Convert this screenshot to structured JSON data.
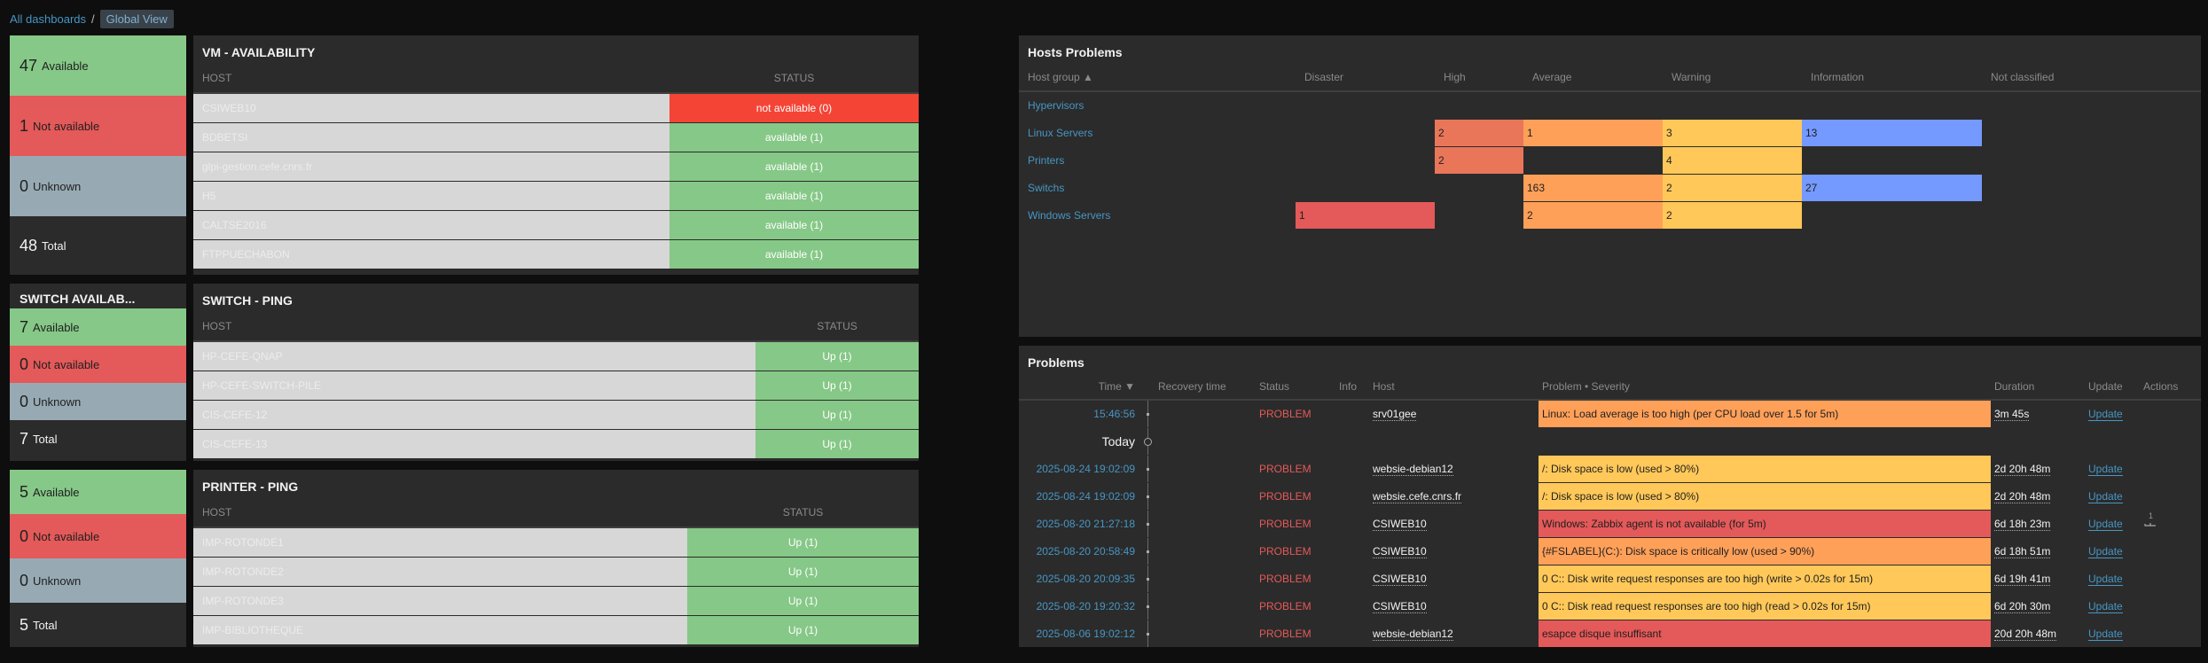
{
  "breadcrumb": {
    "root": "All dashboards",
    "separator": "/",
    "current": "Global View"
  },
  "vm_avail": {
    "available": "47",
    "available_label": "Available",
    "not_available": "1",
    "not_available_label": "Not available",
    "unknown": "0",
    "unknown_label": "Unknown",
    "total": "48",
    "total_label": "Total"
  },
  "switch_avail": {
    "title": "SWITCH AVAILAB...",
    "available": "7",
    "available_label": "Available",
    "not_available": "0",
    "not_available_label": "Not available",
    "unknown": "0",
    "unknown_label": "Unknown",
    "total": "7",
    "total_label": "Total"
  },
  "printer_avail": {
    "available": "5",
    "available_label": "Available",
    "not_available": "0",
    "not_available_label": "Not available",
    "unknown": "0",
    "unknown_label": "Unknown",
    "total": "5",
    "total_label": "Total"
  },
  "vm_table": {
    "title": "VM - AVAILABILITY",
    "col_host": "HOST",
    "col_status": "STATUS",
    "rows": [
      {
        "host": "CSIWEB10",
        "status": "not available (0)"
      },
      {
        "host": "BDBETSI",
        "status": "available (1)"
      },
      {
        "host": "glpi-gestion.cefe.cnrs.fr",
        "status": "available (1)"
      },
      {
        "host": "H5",
        "status": "available (1)"
      },
      {
        "host": "CALTSE2016",
        "status": "available (1)"
      },
      {
        "host": "FTPPUECHABON",
        "status": "available (1)"
      }
    ]
  },
  "switch_table": {
    "title": "SWITCH - PING",
    "col_host": "HOST",
    "col_status": "STATUS",
    "rows": [
      {
        "host": "HP-CEFE-QNAP",
        "status": "Up (1)"
      },
      {
        "host": "HP-CEFE-SWITCH-PILE",
        "status": "Up (1)"
      },
      {
        "host": "CIS-CEFE-12",
        "status": "Up (1)"
      },
      {
        "host": "CIS-CEFE-13",
        "status": "Up (1)"
      }
    ]
  },
  "printer_table": {
    "title": "PRINTER - PING",
    "col_host": "HOST",
    "col_status": "STATUS",
    "rows": [
      {
        "host": "IMP-ROTONDE1",
        "status": "Up (1)"
      },
      {
        "host": "IMP-ROTONDE2",
        "status": "Up (1)"
      },
      {
        "host": "IMP-ROTONDE3",
        "status": "Up (1)"
      },
      {
        "host": "IMP-BIBLIOTHEQUE",
        "status": "Up (1)"
      }
    ]
  },
  "hosts_problems": {
    "title": "Hosts Problems",
    "cols": [
      "Host group ▲",
      "Disaster",
      "High",
      "Average",
      "Warning",
      "Information",
      "Not classified"
    ],
    "rows": [
      {
        "group": "Hypervisors",
        "disaster": "",
        "high": "",
        "average": "",
        "warning": "",
        "information": "",
        "not_classified": ""
      },
      {
        "group": "Linux Servers",
        "disaster": "",
        "high": "2",
        "average": "1",
        "warning": "3",
        "information": "13",
        "not_classified": ""
      },
      {
        "group": "Printers",
        "disaster": "",
        "high": "2",
        "average": "",
        "warning": "4",
        "information": "",
        "not_classified": ""
      },
      {
        "group": "Switchs",
        "disaster": "",
        "high": "",
        "average": "163",
        "warning": "2",
        "information": "27",
        "not_classified": ""
      },
      {
        "group": "Windows Servers",
        "disaster": "1",
        "high": "",
        "average": "2",
        "warning": "2",
        "information": "",
        "not_classified": ""
      }
    ]
  },
  "problems": {
    "title": "Problems",
    "cols": {
      "time": "Time ▼",
      "recovery": "Recovery time",
      "status": "Status",
      "info": "Info",
      "host": "Host",
      "problem": "Problem • Severity",
      "duration": "Duration",
      "update": "Update",
      "actions": "Actions"
    },
    "today_label": "Today",
    "rows": [
      {
        "time": "15:46:56",
        "status": "PROBLEM",
        "host": "srv01gee",
        "problem": "Linux: Load average is too high (per CPU load over 1.5 for 5m)",
        "severity": "avg",
        "duration": "3m 45s",
        "update": "Update"
      },
      {
        "time": "2025-08-24 19:02:09",
        "status": "PROBLEM",
        "host": "websie-debian12",
        "problem": "/: Disk space is low (used > 80%)",
        "severity": "war",
        "duration": "2d 20h 48m",
        "update": "Update"
      },
      {
        "time": "2025-08-24 19:02:09",
        "status": "PROBLEM",
        "host": "websie.cefe.cnrs.fr",
        "problem": "/: Disk space is low (used > 80%)",
        "severity": "war",
        "duration": "2d 20h 48m",
        "update": "Update"
      },
      {
        "time": "2025-08-20 21:27:18",
        "status": "PROBLEM",
        "host": "CSIWEB10",
        "problem": "Windows: Zabbix agent is not available (for 5m)",
        "severity": "dis",
        "duration": "6d 18h 23m",
        "update": "Update",
        "action_count": "1"
      },
      {
        "time": "2025-08-20 20:58:49",
        "status": "PROBLEM",
        "host": "CSIWEB10",
        "problem": "{#FSLABEL}(C:): Disk space is critically low (used > 90%)",
        "severity": "avg",
        "duration": "6d 18h 51m",
        "update": "Update"
      },
      {
        "time": "2025-08-20 20:09:35",
        "status": "PROBLEM",
        "host": "CSIWEB10",
        "problem": "0 C:: Disk write request responses are too high (write > 0.02s for 15m)",
        "severity": "war",
        "duration": "6d 19h 41m",
        "update": "Update"
      },
      {
        "time": "2025-08-20 19:20:32",
        "status": "PROBLEM",
        "host": "CSIWEB10",
        "problem": "0 C:: Disk read request responses are too high (read > 0.02s for 15m)",
        "severity": "war",
        "duration": "6d 20h 30m",
        "update": "Update"
      },
      {
        "time": "2025-08-06 19:02:12",
        "status": "PROBLEM",
        "host": "websie-debian12",
        "problem": "esapce disque insuffisant",
        "severity": "dis",
        "duration": "20d 20h 48m",
        "update": "Update"
      }
    ]
  }
}
